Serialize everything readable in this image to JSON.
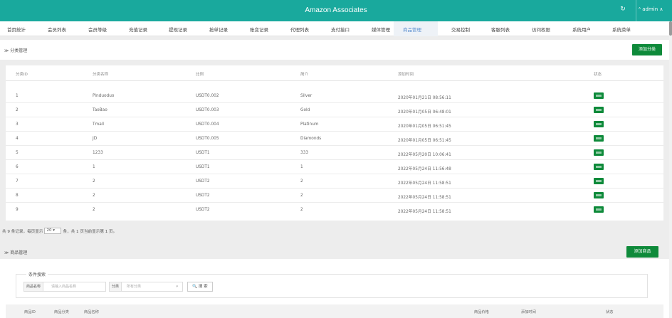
{
  "app": {
    "title": "Amazon Associates",
    "refresh_icon": "↻",
    "user_label": "ᴬ admin ∧"
  },
  "nav": {
    "items": [
      "首页统计",
      "会员列表",
      "会员等级",
      "充值记录",
      "提现记录",
      "抢单记录",
      "账变记录",
      "代理列表",
      "支付接口",
      "媒体管理",
      "商品管理",
      "交易控制",
      "客服列表",
      "访问权限",
      "系统用户",
      "系统菜单"
    ],
    "active_index": 10
  },
  "category": {
    "section_label": "≫ 分类管理",
    "add_button": "添加分类",
    "headers": [
      "分类ID",
      "分类名称",
      "比例",
      "简介",
      "添加时间",
      "状态"
    ],
    "rows": [
      {
        "id": "1",
        "name": "Pinduoduo",
        "ratio": "USDT0.002",
        "intro": "Silver",
        "time": "2020年01月21日 08:56:11"
      },
      {
        "id": "2",
        "name": "TaoBao",
        "ratio": "USDT0.003",
        "intro": "Gold",
        "time": "2020年01月05日 06:48:01"
      },
      {
        "id": "3",
        "name": "Tmall",
        "ratio": "USDT0.004",
        "intro": "Platinum",
        "time": "2020年01月05日 06:51:45"
      },
      {
        "id": "4",
        "name": "JD",
        "ratio": "USDT0.005",
        "intro": "Diamonds",
        "time": "2020年01月05日 06:51:45"
      },
      {
        "id": "5",
        "name": "1233",
        "ratio": "USDT1",
        "intro": "333",
        "time": "2022年05月20日 10:06:41"
      },
      {
        "id": "6",
        "name": "1",
        "ratio": "USDT1",
        "intro": "1",
        "time": "2022年05月24日 11:56:48"
      },
      {
        "id": "7",
        "name": "2",
        "ratio": "USDT2",
        "intro": "2",
        "time": "2022年05月24日 11:58:51"
      },
      {
        "id": "8",
        "name": "2",
        "ratio": "USDT2",
        "intro": "2",
        "time": "2022年05月24日 11:58:51"
      },
      {
        "id": "9",
        "name": "2",
        "ratio": "USDT2",
        "intro": "2",
        "time": "2022年05月24日 11:58:51"
      }
    ],
    "status_icon": "toggle-on-icon"
  },
  "pager": {
    "prefix": "共 9 条记录，每页显示",
    "page_size": "20",
    "suffix": "条，共 1 页当前显示第 1 页。"
  },
  "goods": {
    "section_label": "≫ 商品管理",
    "add_button": "添加商品",
    "search_legend": "条件搜索",
    "name_label": "商品名称",
    "name_placeholder": "请输入商品名称",
    "category_label": "分类",
    "category_value": "所有分类",
    "search_button": "🔍 搜 索",
    "headers": [
      "商品ID",
      "商品分类",
      "商品名称",
      "商品价格",
      "添加时间",
      "状态"
    ]
  },
  "colors": {
    "topbar": "#19a99d",
    "accent_green": "#0e8a3a",
    "active_tab": "#5b8fd0"
  }
}
